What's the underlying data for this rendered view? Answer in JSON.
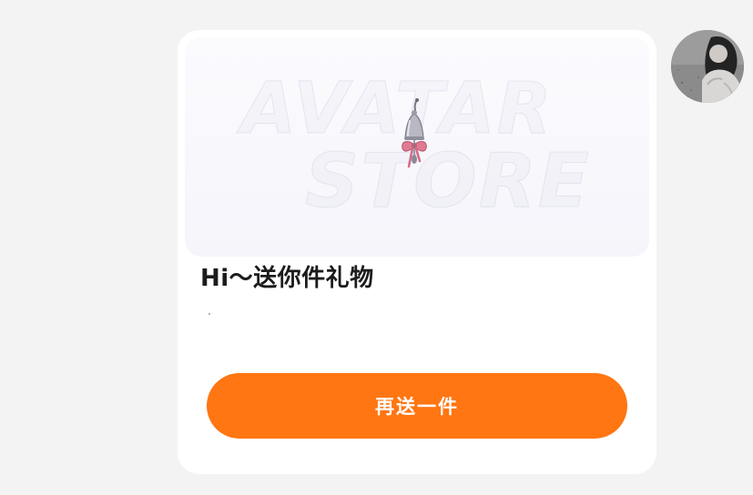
{
  "card": {
    "banner_watermark_line1": "AVATAR",
    "banner_watermark_line2": "STORE",
    "gift_icon": "bell-charm-icon",
    "title": "Hi～送你件礼物",
    "send_button_label": "再送一件"
  },
  "avatar": {
    "icon": "user-avatar-photo"
  },
  "colors": {
    "background": "#f3f3f3",
    "card": "#ffffff",
    "accent": "#ff7612",
    "title_text": "#1c1c1c"
  }
}
